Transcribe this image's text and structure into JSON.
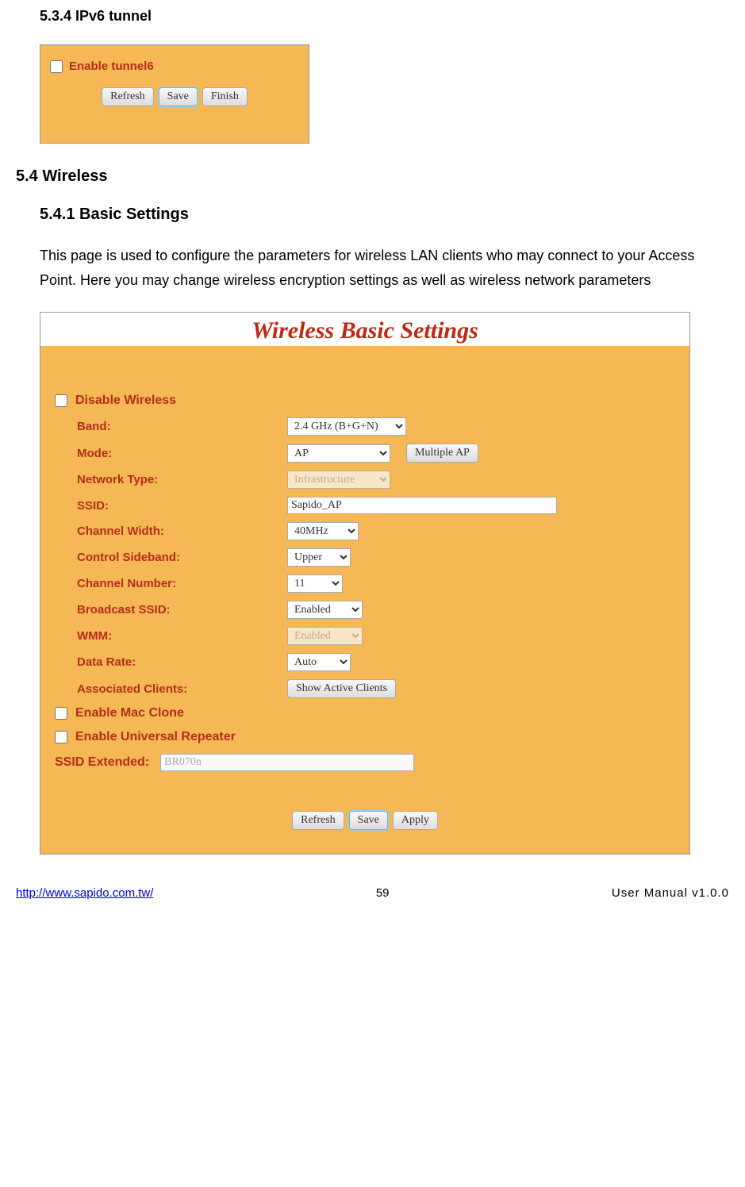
{
  "headings": {
    "h534": "5.3.4    IPv6 tunnel",
    "h54": "5.4    Wireless",
    "h541": "5.4.1    Basic Settings"
  },
  "paragraph": "This page is used to configure the parameters for wireless LAN clients who may connect to your Access Point. Here you may change wireless encryption settings as well as wireless network parameters",
  "tunnel": {
    "checkbox_label": "Enable tunnel6",
    "btn_refresh": "Refresh",
    "btn_save": "Save",
    "btn_finish": "Finish"
  },
  "wireless": {
    "title": "Wireless Basic Settings",
    "disable_label": "Disable Wireless",
    "labels": {
      "band": "Band:",
      "mode": "Mode:",
      "network_type": "Network Type:",
      "ssid": "SSID:",
      "channel_width": "Channel Width:",
      "control_sideband": "Control Sideband:",
      "channel_number": "Channel Number:",
      "broadcast_ssid": "Broadcast SSID:",
      "wmm": "WMM:",
      "data_rate": "Data Rate:",
      "associated_clients": "Associated Clients:",
      "mac_clone": "Enable Mac Clone",
      "universal_repeater": "Enable Universal Repeater",
      "ssid_extended": "SSID Extended:"
    },
    "values": {
      "band": "2.4 GHz (B+G+N)",
      "mode": "AP",
      "multiple_ap_btn": "Multiple AP",
      "network_type": "Infrastructure",
      "ssid": "Sapido_AP",
      "channel_width": "40MHz",
      "control_sideband": "Upper",
      "channel_number": "11",
      "broadcast_ssid": "Enabled",
      "wmm": "Enabled",
      "data_rate": "Auto",
      "show_active_btn": "Show Active Clients",
      "ssid_extended": "BR070n"
    },
    "btn_refresh": "Refresh",
    "btn_save": "Save",
    "btn_apply": "Apply"
  },
  "footer": {
    "url": "http://www.sapido.com.tw/",
    "page": "59",
    "version": "User Manual v1.0.0"
  }
}
